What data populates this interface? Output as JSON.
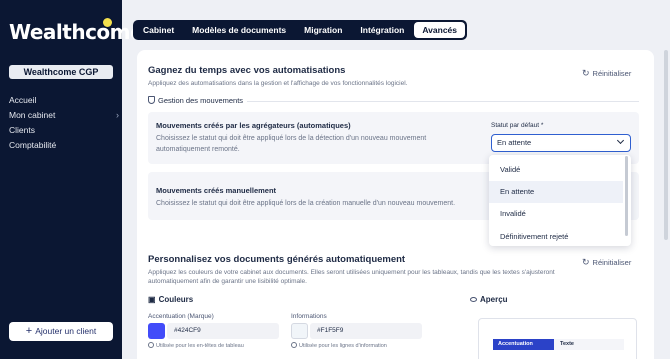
{
  "sidebar": {
    "logo": "Wealthcome",
    "org": "Wealthcome CGP",
    "items": [
      {
        "label": "Accueil"
      },
      {
        "label": "Mon cabinet"
      },
      {
        "label": "Clients"
      },
      {
        "label": "Comptabilité"
      }
    ],
    "add_client": "Ajouter un client"
  },
  "tabs": [
    "Cabinet",
    "Modèles de documents",
    "Migration",
    "Intégration",
    "Avancés"
  ],
  "active_tab": "Avancés",
  "automations": {
    "title": "Gagnez du temps avec vos automatisations",
    "subtitle": "Appliquez des automatisations dans la gestion et l'affichage de vos fonctionnalités logiciel.",
    "reset": "Réinitialiser",
    "group": "Gestion des mouvements",
    "aggregator": {
      "title": "Mouvements créés par les agrégateurs (automatiques)",
      "desc_line1": "Choisissez le statut qui doit être appliqué lors de la détection d'un nouveau mouvement",
      "desc_line2": "automatiquement remonté."
    },
    "manual": {
      "title": "Mouvements créés manuellement",
      "desc": "Choisissez le statut qui doit être appliqué lors de la création manuelle d'un nouveau mouvement."
    },
    "status_label": "Statut par défaut *",
    "status_value": "En attente",
    "options": [
      "Validé",
      "En attente",
      "Invalidé",
      "Définitivement rejeté"
    ]
  },
  "documents": {
    "title": "Personnalisez vos documents générés automatiquement",
    "subtitle_line1": "Appliquez les couleurs de votre cabinet aux documents. Elles seront utilisées uniquement pour les tableaux, tandis que les textes s'ajusteront",
    "subtitle_line2": "automatiquement afin de garantir une lisibilité optimale.",
    "reset": "Réinitialiser",
    "colors_title": "Couleurs",
    "preview_title": "Aperçu",
    "accent": {
      "label": "Accentuation (Marque)",
      "value": "#424CF9",
      "hint": "Utilisée pour les en-têtes de tableau",
      "color": "#424CF9"
    },
    "info": {
      "label": "Informations",
      "value": "#F1F5F9",
      "hint": "Utilisée pour les lignes d'information",
      "color": "#F1F5F9"
    },
    "preview_cols": [
      "Accentuation",
      "Texte"
    ]
  }
}
